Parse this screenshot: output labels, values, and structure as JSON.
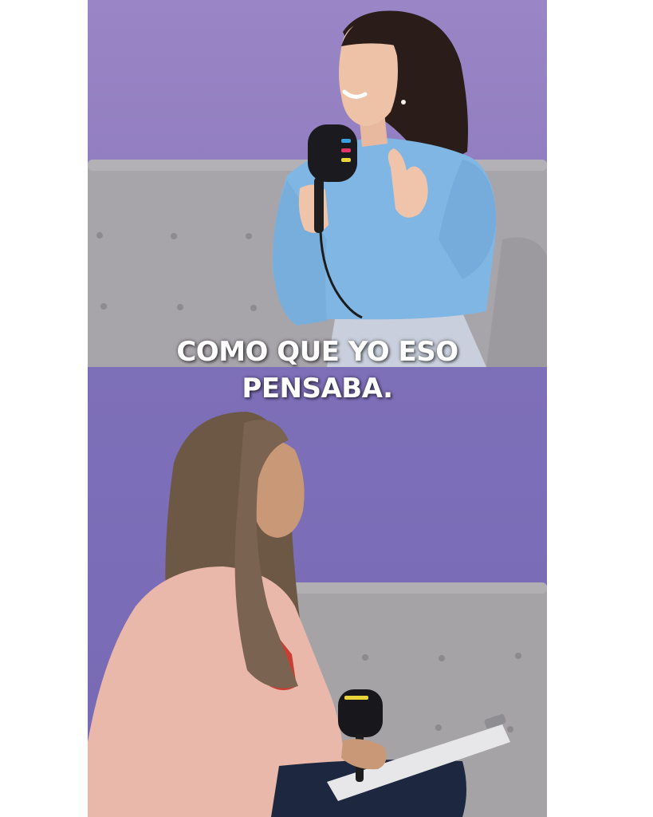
{
  "caption": {
    "line1": "COMO QUE YO ESO",
    "line2": "PENSABA."
  },
  "colors": {
    "page_background": "#ffffff",
    "wall_top": "#9a86c6",
    "wall_bottom": "#7e6fb9",
    "sofa": "#a9a6ab",
    "sweater": "#7fb6e3",
    "blazer": "#e9b8aa",
    "caption_text": "#ffffff"
  },
  "scene": {
    "top_panel": "guest-speaking",
    "bottom_panel": "interviewer-listening"
  }
}
